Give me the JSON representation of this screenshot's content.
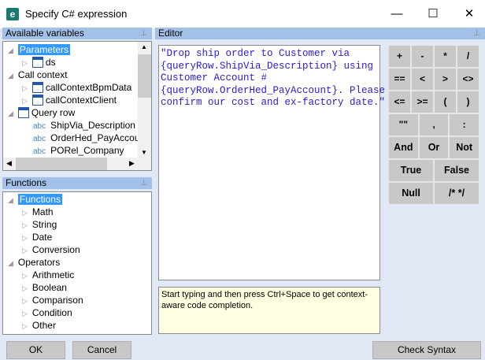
{
  "window": {
    "title": "Specify C# expression",
    "icon": "e",
    "minimize": "—",
    "maximize": "☐",
    "close": "✕"
  },
  "variables_panel": {
    "title": "Available variables",
    "items": [
      {
        "label": "Parameters",
        "level": 0,
        "icon": "none",
        "selected": true
      },
      {
        "label": "ds",
        "level": 1,
        "icon": "table-icon"
      },
      {
        "label": "Call context",
        "level": 0,
        "icon": "none"
      },
      {
        "label": "callContextBpmData",
        "level": 1,
        "icon": "table-icon"
      },
      {
        "label": "callContextClient",
        "level": 1,
        "icon": "table-icon"
      },
      {
        "label": "Query row",
        "level": 0,
        "icon": "table-icon"
      },
      {
        "label": "ShipVia_Description",
        "level": 2,
        "icon": "abc"
      },
      {
        "label": "OrderHed_PayAccou",
        "level": 2,
        "icon": "abc"
      },
      {
        "label": "PORel_Company",
        "level": 2,
        "icon": "abc"
      }
    ]
  },
  "functions_panel": {
    "title": "Functions",
    "items": [
      {
        "label": "Functions",
        "level": 0,
        "selected": true
      },
      {
        "label": "Math",
        "level": 1
      },
      {
        "label": "String",
        "level": 1
      },
      {
        "label": "Date",
        "level": 1
      },
      {
        "label": "Conversion",
        "level": 1
      },
      {
        "label": "Operators",
        "level": 0
      },
      {
        "label": "Arithmetic",
        "level": 1
      },
      {
        "label": "Boolean",
        "level": 1
      },
      {
        "label": "Comparison",
        "level": 1
      },
      {
        "label": "Condition",
        "level": 1
      },
      {
        "label": "Other",
        "level": 1
      }
    ]
  },
  "editor": {
    "title": "Editor",
    "text": "\"Drop ship order to Customer via\n{queryRow.ShipVia_Description} using\nCustomer Account #\n{queryRow.OrderHed_PayAccount}. Please\nconfirm our cost and ex-factory date.\"",
    "hint": "Start typing and then press Ctrl+Space to get context-aware code completion."
  },
  "keypad": [
    [
      "+",
      "-",
      "*",
      "/"
    ],
    [
      "==",
      "<",
      ">",
      "<>"
    ],
    [
      "<=",
      ">=",
      "(",
      ")"
    ],
    [
      "\"\"",
      ",",
      ":"
    ],
    [
      "And",
      "Or",
      "Not"
    ],
    [
      "True",
      "False"
    ],
    [
      "Null",
      "/* */"
    ]
  ],
  "buttons": {
    "ok": "OK",
    "cancel": "Cancel",
    "check": "Check Syntax"
  }
}
